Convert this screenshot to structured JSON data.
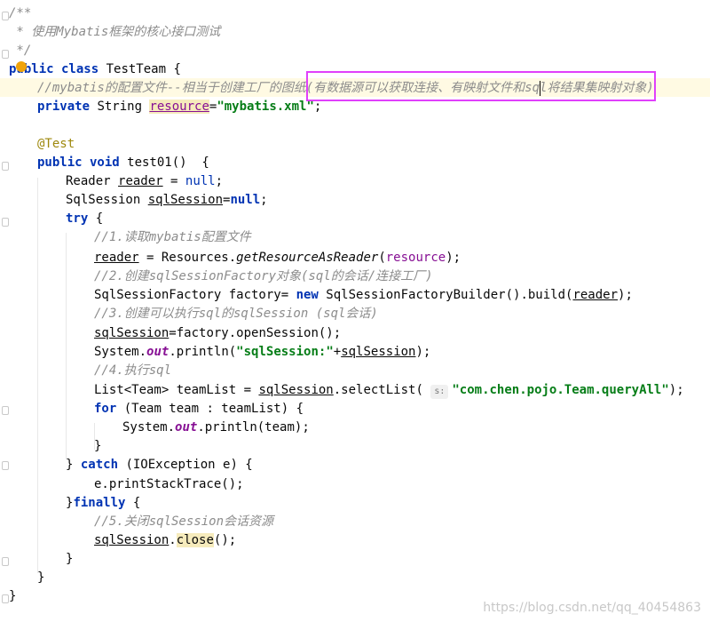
{
  "editor": {
    "lines": {
      "l1": "/**",
      "l2": " * 使用Mybatis框架的核心接口测试",
      "l3": " */",
      "l4_kw": "public class",
      "l4_name": " TestTeam {",
      "l5": "//mybatis的配置文件--相当于创建工厂的图纸(有数据源可以获取连接、有映射文件和sql将结果集映射对象)",
      "l6_kw": "private",
      "l6_type": " String ",
      "l6_field": "resource",
      "l6_eq": "=",
      "l6_str": "\"mybatis.xml\"",
      "l6_end": ";",
      "l8": "@Test",
      "l9_kw": "public void",
      "l9_rest": " test01()  {",
      "l10_type": "Reader ",
      "l10_var": "reader",
      "l10_eq": " = ",
      "l10_null": "null",
      "l10_end": ";",
      "l11_type": "SqlSession ",
      "l11_var": "sqlSession",
      "l11_eq": "=",
      "l11_null": "null",
      "l11_end": ";",
      "l12_kw": "try",
      "l12_rest": " {",
      "l13": "//1.读取mybatis配置文件",
      "l14_var": "reader",
      "l14_eq": " = Resources.",
      "l14_mth": "getResourceAsReader",
      "l14_open": "(",
      "l14_res": "resource",
      "l14_end": ");",
      "l15": "//2.创建sqlSessionFactory对象(sql的会话/连接工厂)",
      "l16_a": "SqlSessionFactory factory= ",
      "l16_kw": "new",
      "l16_b": " SqlSessionFactoryBuilder().build(",
      "l16_var": "reader",
      "l16_end": ");",
      "l17": "//3.创建可以执行sql的sqlSession (sql会话)",
      "l18_var": "sqlSession",
      "l18_rest": "=factory.openSession();",
      "l19_a": "System.",
      "l19_out": "out",
      "l19_b": ".println(",
      "l19_str": "\"sqlSession:\"",
      "l19_plus": "+",
      "l19_var": "sqlSession",
      "l19_end": ");",
      "l20": "//4.执行sql",
      "l21_a": "List<Team> teamList = ",
      "l21_var": "sqlSession",
      "l21_b": ".selectList( ",
      "l21_hint": "s:",
      "l21_str": "\"com.chen.pojo.Team.queryAll\"",
      "l21_end": ");",
      "l22_kw": "for",
      "l22_rest": " (Team team : teamList) {",
      "l23_a": "System.",
      "l23_out": "out",
      "l23_b": ".println(team);",
      "l24": "}",
      "l25_a": "} ",
      "l25_kw": "catch",
      "l25_b": " (IOException e) {",
      "l26": "e.printStackTrace();",
      "l27_a": "}",
      "l27_kw": "finally",
      "l27_b": " {",
      "l28": "//5.关闭sqlSession会话资源",
      "l29_var": "sqlSession",
      "l29_dot": ".",
      "l29_close": "close",
      "l29_end": "();",
      "l30": "}",
      "l31": "}",
      "l32": "}"
    }
  },
  "watermark": "https://blog.csdn.net/qq_40454863",
  "colors": {
    "keyword": "#0033b3",
    "string": "#067d17",
    "comment": "#8c8c8c",
    "annotation": "#9e880d",
    "field": "#871094",
    "selection_box": "#e040fb",
    "current_line": "#fffae3"
  },
  "icons": {
    "bulb": "lightbulb-icon",
    "fold": "fold-marker-icon"
  }
}
